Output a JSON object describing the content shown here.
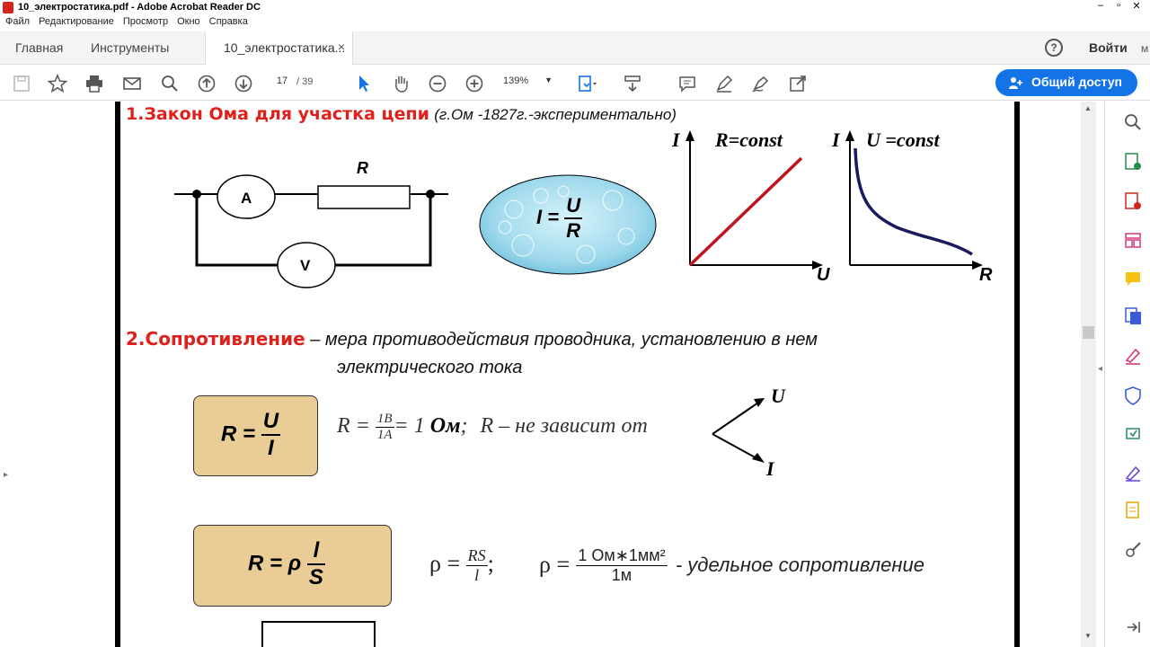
{
  "window": {
    "title": "10_электростатика.pdf - Adobe Acrobat Reader DC"
  },
  "menu": [
    "Файл",
    "Редактирование",
    "Просмотр",
    "Окно",
    "Справка"
  ],
  "tabs": {
    "home": "Главная",
    "tools": "Инструменты",
    "doc": "10_электростатика...",
    "close": "×"
  },
  "header": {
    "help": "?",
    "signin": "Войти",
    "more": "м"
  },
  "toolbar": {
    "page_current": "17",
    "page_sep": "/",
    "page_total": "39",
    "zoom": "139%"
  },
  "share": {
    "label": "Общий доступ"
  },
  "content": {
    "s1_title": "1.Закон Ома для участка цепи",
    "s1_note": "(г.Ом -1827г.-экспериментально)",
    "circuit": {
      "ammeter": "A",
      "voltmeter": "V",
      "resistor": "R"
    },
    "ohm_formula": {
      "lhs": "I =",
      "num": "U",
      "den": "R"
    },
    "graph1": {
      "yaxis": "I",
      "xaxis": "U",
      "label": "R=const"
    },
    "graph2": {
      "yaxis": "I",
      "xaxis": "R",
      "label": "U =const"
    },
    "s2_title": "2.Сопротивление",
    "s2_def1": "– мера противодействия проводника, установлению в нем",
    "s2_def2": "электрического тока",
    "box1": {
      "lhs": "R =",
      "num": "U",
      "den": "I"
    },
    "unit_line": {
      "lhs": "R =",
      "num": "1В",
      "den": "1А",
      "rhs": "= 1",
      "unit": "Ом",
      "semi": ";",
      "tail": "R – не зависит от"
    },
    "arrows": {
      "up": "U",
      "down": "I"
    },
    "box2": {
      "lhs": "R = ρ",
      "num": "l",
      "den": "S"
    },
    "rho1": {
      "lhs": "ρ =",
      "num": "RS",
      "den": "l",
      "semi": ";"
    },
    "rho2": {
      "lhs": "ρ =",
      "num": "1 Ом∗1мм²",
      "den": "1м",
      "tail": "- удельное сопротивление"
    }
  },
  "colors": {
    "accent": "#1473e6",
    "heading_red": "#e0201b",
    "paper": "#e9cc96",
    "line_red": "#c0141c",
    "curve_blue": "#1a1a5e"
  },
  "icons": [
    "save-icon",
    "star-icon",
    "print-icon",
    "mail-icon",
    "search-icon",
    "page-up-icon",
    "page-down-icon",
    "select-arrow-icon",
    "hand-icon",
    "zoom-out-icon",
    "zoom-in-icon",
    "fit-icon",
    "scroll-icon",
    "comment-icon",
    "pen-icon",
    "sign-icon",
    "share-tools-icon"
  ]
}
